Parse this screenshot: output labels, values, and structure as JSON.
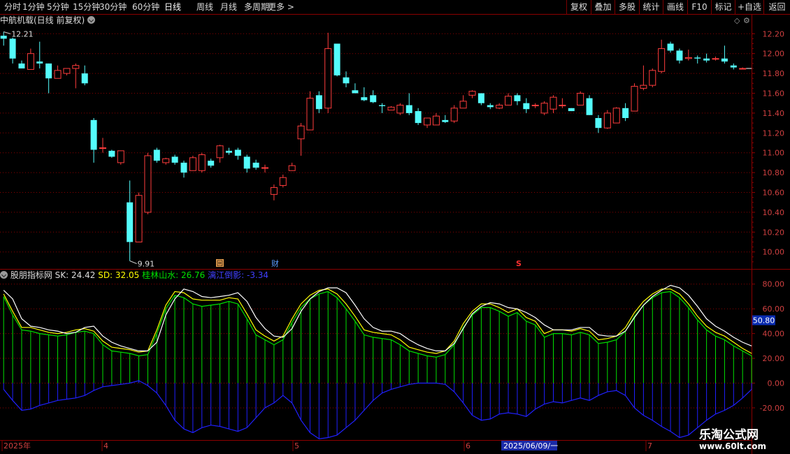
{
  "toolbar": {
    "left": [
      "分时",
      "1分钟",
      "5分钟",
      "15分钟",
      "30分钟",
      "60分钟",
      "日线",
      "周线",
      "月线",
      "多周期",
      "更多 >"
    ],
    "active": "日线",
    "right": [
      "复权",
      "叠加",
      "多股",
      "统计",
      "画线",
      "F10",
      "标记",
      "+自选",
      "返回"
    ]
  },
  "kline_title": "中航机载(日线 前复权)",
  "price_axis": [
    "12.20",
    "12.00",
    "11.80",
    "11.60",
    "11.40",
    "11.20",
    "11.00",
    "10.80",
    "10.60",
    "10.40",
    "10.20",
    "10.00"
  ],
  "price_high_label": "12.21",
  "price_low_label": "9.91",
  "markers": {
    "hui": "回",
    "cai": "财",
    "s": "S"
  },
  "indicator": {
    "name": "股朋指标网",
    "sk_label": "SK: 24.42",
    "sd_label": "SD: 32.05",
    "glss_label": "桂林山水: 26.76",
    "lj_label": "漓江倒影: -3.34",
    "axis": [
      "80.00",
      "60.00",
      "40.00",
      "20.00",
      "0.00",
      "-20.00"
    ],
    "current_tag": "50.80"
  },
  "date_axis": {
    "labels": [
      "2025年",
      "4",
      "5",
      "6",
      "7"
    ],
    "cursor": "2025/06/09/一"
  },
  "watermark": {
    "line1": "乐淘公式网",
    "line2": "www.60lt.com"
  },
  "colors": {
    "up": "#ff3c3c",
    "down": "#54fcfc",
    "grid": "#8b0000",
    "sk": "#ffff00",
    "sd": "#ffffff",
    "glss": "#00e000",
    "lj": "#2020ff"
  },
  "chart_data": [
    {
      "type": "candlestick",
      "title": "中航机载(日线 前复权)",
      "ylim": [
        9.85,
        12.3
      ],
      "ohlc": [
        [
          12.18,
          12.22,
          12.08,
          12.15
        ],
        [
          12.15,
          12.16,
          11.9,
          11.95
        ],
        [
          11.9,
          11.93,
          11.85,
          11.85
        ],
        [
          11.84,
          12.05,
          11.84,
          12.0
        ],
        [
          11.92,
          12.12,
          11.85,
          11.9
        ],
        [
          11.9,
          11.9,
          11.6,
          11.75
        ],
        [
          11.75,
          11.88,
          11.75,
          11.83
        ],
        [
          11.8,
          11.85,
          11.78,
          11.85
        ],
        [
          11.85,
          11.9,
          11.65,
          11.88
        ],
        [
          11.8,
          11.88,
          11.68,
          11.7
        ],
        [
          11.33,
          11.35,
          10.9,
          11.03
        ],
        [
          11.05,
          11.15,
          11.0,
          11.05
        ],
        [
          11.02,
          11.03,
          10.95,
          10.96
        ],
        [
          10.9,
          11.02,
          10.88,
          11.02
        ],
        [
          10.5,
          10.72,
          9.91,
          10.1
        ],
        [
          10.1,
          10.6,
          10.1,
          10.57
        ],
        [
          10.4,
          11.0,
          10.38,
          10.97
        ],
        [
          11.03,
          11.05,
          10.9,
          10.92
        ],
        [
          10.9,
          10.95,
          10.88,
          10.94
        ],
        [
          10.96,
          10.98,
          10.88,
          10.9
        ],
        [
          10.9,
          10.92,
          10.75,
          10.8
        ],
        [
          10.82,
          10.97,
          10.82,
          10.95
        ],
        [
          10.82,
          11.0,
          10.8,
          10.98
        ],
        [
          10.92,
          10.94,
          10.85,
          10.87
        ],
        [
          10.95,
          11.08,
          10.9,
          11.07
        ],
        [
          11.02,
          11.05,
          10.98,
          11.0
        ],
        [
          11.03,
          11.05,
          10.93,
          10.97
        ],
        [
          10.96,
          10.98,
          10.8,
          10.84
        ],
        [
          10.9,
          10.93,
          10.83,
          10.85
        ],
        [
          10.85,
          10.88,
          10.8,
          10.85
        ],
        [
          10.58,
          10.68,
          10.52,
          10.65
        ],
        [
          10.67,
          10.78,
          10.65,
          10.75
        ],
        [
          10.82,
          10.9,
          10.82,
          10.87
        ],
        [
          11.14,
          11.3,
          10.97,
          11.27
        ],
        [
          11.23,
          11.62,
          11.23,
          11.55
        ],
        [
          11.58,
          11.62,
          11.4,
          11.44
        ],
        [
          11.45,
          12.21,
          11.4,
          12.05
        ],
        [
          12.1,
          12.1,
          11.77,
          11.78
        ],
        [
          11.76,
          11.82,
          11.66,
          11.7
        ],
        [
          11.63,
          11.7,
          11.6,
          11.6
        ],
        [
          11.56,
          11.66,
          11.52,
          11.53
        ],
        [
          11.58,
          11.63,
          11.5,
          11.51
        ],
        [
          11.48,
          11.5,
          11.4,
          11.47
        ],
        [
          11.43,
          11.47,
          11.43,
          11.46
        ],
        [
          11.4,
          11.5,
          11.38,
          11.48
        ],
        [
          11.48,
          11.6,
          11.38,
          11.4
        ],
        [
          11.42,
          11.45,
          11.28,
          11.3
        ],
        [
          11.28,
          11.35,
          11.25,
          11.35
        ],
        [
          11.28,
          11.4,
          11.28,
          11.37
        ],
        [
          11.33,
          11.38,
          11.3,
          11.31
        ],
        [
          11.32,
          11.48,
          11.3,
          11.45
        ],
        [
          11.45,
          11.58,
          11.45,
          11.52
        ],
        [
          11.58,
          11.63,
          11.55,
          11.62
        ],
        [
          11.6,
          11.6,
          11.48,
          11.5
        ],
        [
          11.48,
          11.5,
          11.44,
          11.46
        ],
        [
          11.45,
          11.5,
          11.44,
          11.48
        ],
        [
          11.48,
          11.6,
          11.48,
          11.57
        ],
        [
          11.58,
          11.6,
          11.48,
          11.52
        ],
        [
          11.5,
          11.55,
          11.4,
          11.44
        ],
        [
          11.48,
          11.5,
          11.45,
          11.48
        ],
        [
          11.4,
          11.52,
          11.38,
          11.5
        ],
        [
          11.44,
          11.58,
          11.4,
          11.56
        ],
        [
          11.48,
          11.55,
          11.45,
          11.48
        ],
        [
          11.45,
          11.45,
          11.42,
          11.42
        ],
        [
          11.48,
          11.62,
          11.48,
          11.6
        ],
        [
          11.55,
          11.58,
          11.38,
          11.38
        ],
        [
          11.35,
          11.38,
          11.2,
          11.25
        ],
        [
          11.25,
          11.43,
          11.24,
          11.4
        ],
        [
          11.3,
          11.46,
          11.3,
          11.45
        ],
        [
          11.45,
          11.5,
          11.32,
          11.35
        ],
        [
          11.42,
          11.7,
          11.42,
          11.67
        ],
        [
          11.65,
          11.88,
          11.63,
          11.68
        ],
        [
          11.68,
          11.85,
          11.66,
          11.83
        ],
        [
          11.82,
          12.14,
          11.8,
          12.05
        ],
        [
          12.1,
          12.12,
          12.01,
          12.03
        ],
        [
          12.03,
          12.05,
          11.9,
          11.93
        ],
        [
          11.95,
          12.04,
          11.93,
          11.96
        ],
        [
          11.96,
          11.98,
          11.9,
          11.95
        ],
        [
          11.95,
          12.0,
          11.91,
          11.93
        ],
        [
          11.95,
          11.97,
          11.93,
          11.95
        ],
        [
          11.95,
          12.08,
          11.9,
          11.92
        ],
        [
          11.88,
          11.9,
          11.84,
          11.86
        ],
        [
          11.85,
          11.86,
          11.84,
          11.85
        ]
      ],
      "yaxis_labels": [
        "12.20",
        "12.00",
        "11.80",
        "11.60",
        "11.40",
        "11.20",
        "11.00",
        "10.80",
        "10.60",
        "10.40",
        "10.20",
        "10.00"
      ]
    },
    {
      "type": "line",
      "title": "股朋指标网",
      "ylim": [
        -25,
        88
      ],
      "series": [
        {
          "name": "SK",
          "values": [
            72,
            58,
            45,
            45,
            43,
            41,
            40,
            41,
            43,
            44,
            42,
            34,
            29,
            28,
            27,
            25,
            26,
            43,
            63,
            74,
            73,
            68,
            67,
            67,
            67,
            69,
            68,
            56,
            43,
            38,
            34,
            38,
            52,
            64,
            71,
            75,
            76,
            72,
            64,
            54,
            43,
            41,
            40,
            39,
            35,
            29,
            27,
            25,
            24,
            26,
            34,
            48,
            58,
            64,
            64,
            61,
            57,
            60,
            53,
            50,
            40,
            43,
            43,
            42,
            44,
            42,
            35,
            36,
            38,
            45,
            57,
            66,
            72,
            76,
            76,
            72,
            64,
            54,
            46,
            41,
            38,
            33,
            28,
            24
          ]
        },
        {
          "name": "SD",
          "values": [
            75,
            68,
            52,
            46,
            45,
            43,
            42,
            40,
            41,
            45,
            46,
            38,
            33,
            30,
            28,
            26,
            26,
            33,
            55,
            68,
            76,
            74,
            70,
            69,
            70,
            71,
            73,
            66,
            53,
            44,
            38,
            37,
            44,
            58,
            68,
            74,
            77,
            77,
            73,
            63,
            52,
            45,
            42,
            42,
            40,
            35,
            31,
            28,
            26,
            26,
            32,
            44,
            56,
            62,
            65,
            64,
            61,
            60,
            57,
            53,
            47,
            43,
            43,
            43,
            45,
            45,
            39,
            38,
            38,
            42,
            53,
            63,
            70,
            75,
            79,
            77,
            71,
            62,
            52,
            46,
            42,
            37,
            33,
            30
          ]
        },
        {
          "name": "桂林山水",
          "values": [
            70,
            55,
            43,
            42,
            40,
            39,
            38,
            39,
            41,
            42,
            40,
            31,
            26,
            25,
            24,
            22,
            23,
            40,
            60,
            71,
            69,
            64,
            62,
            63,
            64,
            66,
            64,
            52,
            39,
            35,
            31,
            35,
            49,
            61,
            68,
            72,
            74,
            69,
            60,
            50,
            39,
            37,
            36,
            35,
            31,
            26,
            24,
            22,
            21,
            23,
            31,
            45,
            55,
            61,
            61,
            58,
            54,
            57,
            50,
            47,
            37,
            40,
            40,
            39,
            41,
            39,
            32,
            33,
            35,
            42,
            54,
            63,
            69,
            73,
            74,
            69,
            61,
            51,
            43,
            38,
            35,
            30,
            26,
            22
          ]
        },
        {
          "name": "漓江倒影",
          "values": [
            -5,
            -14,
            -22,
            -21,
            -18,
            -16,
            -14,
            -13,
            -12,
            -10,
            -6,
            -3,
            -2,
            -1,
            0,
            2,
            -2,
            -8,
            -18,
            -30,
            -37,
            -40,
            -36,
            -34,
            -35,
            -37,
            -39,
            -36,
            -28,
            -20,
            -16,
            -10,
            -16,
            -30,
            -40,
            -45,
            -44,
            -42,
            -36,
            -30,
            -22,
            -14,
            -8,
            -5,
            -3,
            -1,
            0,
            0,
            0,
            -1,
            -7,
            -16,
            -26,
            -30,
            -29,
            -25,
            -24,
            -25,
            -27,
            -21,
            -17,
            -15,
            -16,
            -14,
            -12,
            -14,
            -10,
            -7,
            -6,
            -10,
            -20,
            -26,
            -30,
            -35,
            -39,
            -44,
            -42,
            -36,
            -30,
            -25,
            -22,
            -18,
            -12,
            -5
          ]
        }
      ],
      "yaxis_labels": [
        "80.00",
        "60.00",
        "40.00",
        "20.00",
        "0.00",
        "-20.00"
      ]
    }
  ]
}
